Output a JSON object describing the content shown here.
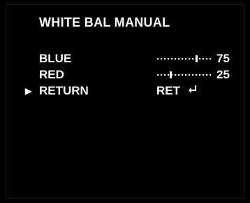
{
  "title": "WHITE BAL MANUAL",
  "menu": {
    "items": [
      {
        "label": "BLUE",
        "value": "75",
        "level": 0.75,
        "selected": false
      },
      {
        "label": "RED",
        "value": "25",
        "level": 0.25,
        "selected": false
      },
      {
        "label": "RETURN",
        "action": "RET",
        "selected": true
      }
    ]
  },
  "icons": {
    "pointer": "play-triangle-icon",
    "return": "enter-return-icon"
  },
  "pointer_glyph": "▶",
  "colors": {
    "background": "#000000",
    "text": "#ffffff"
  }
}
